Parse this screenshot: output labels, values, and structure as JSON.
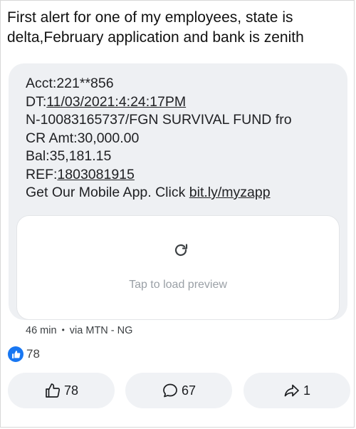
{
  "post": {
    "text_line1": "First alert for one of my employees, state is",
    "text_line2": "delta,February application and bank is zenith"
  },
  "sms": {
    "acct": "Acct:221**856",
    "dt_prefix": "DT:",
    "dt_value": "11/03/2021:4:24:17PM",
    "narration": "N-10083165737/FGN SURVIVAL FUND fro",
    "cr_amt": "CR Amt:30,000.00",
    "bal": "Bal:35,181.15",
    "ref_prefix": "REF:",
    "ref_value": "1803081915",
    "app_prefix": "Get Our Mobile App. Click ",
    "app_link": "bit.ly/myzapp"
  },
  "preview": {
    "label": "Tap to load preview",
    "icon": "reload-icon"
  },
  "meta": {
    "time": "46 min",
    "separator": "•",
    "via": "via MTN - NG"
  },
  "reactions": {
    "icon": "like-badge-icon",
    "count": "78"
  },
  "actions": {
    "like_count": "78",
    "comment_count": "67",
    "share_count": "1"
  },
  "colors": {
    "accent": "#1877f2",
    "card_bg": "#eef0f3",
    "button_bg": "#f0f2f5"
  }
}
